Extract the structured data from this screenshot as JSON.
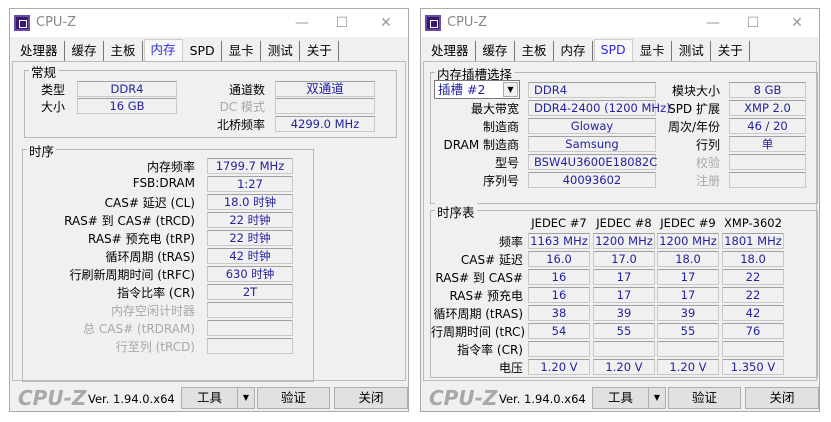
{
  "app_title": "CPU-Z",
  "tabs": [
    "处理器",
    "缓存",
    "主板",
    "内存",
    "SPD",
    "显卡",
    "测试",
    "关于"
  ],
  "left": {
    "active_tab": "内存",
    "general": {
      "title": "常规",
      "type_label": "类型",
      "type_value": "DDR4",
      "size_label": "大小",
      "size_value": "16 GB",
      "channels_label": "通道数",
      "channels_value": "双通道",
      "dc_mode_label": "DC 模式",
      "dc_mode_value": "",
      "nb_freq_label": "北桥频率",
      "nb_freq_value": "4299.0 MHz"
    },
    "timings": {
      "title": "时序",
      "rows": [
        {
          "label": "内存频率",
          "value": "1799.7 MHz",
          "disabled": false
        },
        {
          "label": "FSB:DRAM",
          "value": "1:27",
          "disabled": false
        },
        {
          "label": "CAS# 延迟 (CL)",
          "value": "18.0 时钟",
          "disabled": false
        },
        {
          "label": "RAS# 到 CAS# (tRCD)",
          "value": "22 时钟",
          "disabled": false
        },
        {
          "label": "RAS# 预充电 (tRP)",
          "value": "22 时钟",
          "disabled": false
        },
        {
          "label": "循环周期 (tRAS)",
          "value": "42 时钟",
          "disabled": false
        },
        {
          "label": "行刷新周期时间 (tRFC)",
          "value": "630 时钟",
          "disabled": false
        },
        {
          "label": "指令比率 (CR)",
          "value": "2T",
          "disabled": false
        },
        {
          "label": "内存空闲计时器",
          "value": "",
          "disabled": true
        },
        {
          "label": "总 CAS# (tRDRAM)",
          "value": "",
          "disabled": true
        },
        {
          "label": "行至列 (tRCD)",
          "value": "",
          "disabled": true
        }
      ]
    }
  },
  "right": {
    "active_tab": "SPD",
    "slot": {
      "title": "内存插槽选择",
      "selected_slot": "插槽 #2",
      "type_value": "DDR4",
      "left_rows": [
        {
          "label": "最大带宽",
          "value": "DDR4-2400 (1200 MHz)"
        },
        {
          "label": "制造商",
          "value": "Gloway"
        },
        {
          "label": "DRAM 制造商",
          "value": "Samsung"
        },
        {
          "label": "型号",
          "value": "BSW4U3600E18082C"
        },
        {
          "label": "序列号",
          "value": "40093602"
        }
      ],
      "right_rows": [
        {
          "label": "模块大小",
          "value": "8 GB",
          "disabled": false
        },
        {
          "label": "SPD 扩展",
          "value": "XMP 2.0",
          "disabled": false
        },
        {
          "label": "周次/年份",
          "value": "46 / 20",
          "disabled": false
        },
        {
          "label": "行列",
          "value": "单",
          "disabled": false
        },
        {
          "label": "校验",
          "value": "",
          "disabled": true
        },
        {
          "label": "注册",
          "value": "",
          "disabled": true
        }
      ]
    },
    "timing_table": {
      "title": "时序表",
      "columns": [
        "JEDEC #7",
        "JEDEC #8",
        "JEDEC #9",
        "XMP-3602"
      ],
      "rows": [
        {
          "label": "频率",
          "values": [
            "1163 MHz",
            "1200 MHz",
            "1200 MHz",
            "1801 MHz"
          ]
        },
        {
          "label": "CAS# 延迟",
          "values": [
            "16.0",
            "17.0",
            "18.0",
            "18.0"
          ]
        },
        {
          "label": "RAS# 到 CAS#",
          "values": [
            "16",
            "17",
            "17",
            "22"
          ]
        },
        {
          "label": "RAS# 预充电",
          "values": [
            "16",
            "17",
            "17",
            "22"
          ]
        },
        {
          "label": "循环周期 (tRAS)",
          "values": [
            "38",
            "39",
            "39",
            "42"
          ]
        },
        {
          "label": "行周期时间 (tRC)",
          "values": [
            "54",
            "55",
            "55",
            "76"
          ]
        },
        {
          "label": "指令率 (CR)",
          "values": [
            "",
            "",
            "",
            ""
          ]
        },
        {
          "label": "电压",
          "values": [
            "1.20 V",
            "1.20 V",
            "1.20 V",
            "1.350 V"
          ]
        }
      ]
    }
  },
  "footer": {
    "logo": "CPU-Z",
    "version": "Ver. 1.94.0.x64",
    "tools": "工具",
    "validate": "验证",
    "close": "关闭"
  }
}
